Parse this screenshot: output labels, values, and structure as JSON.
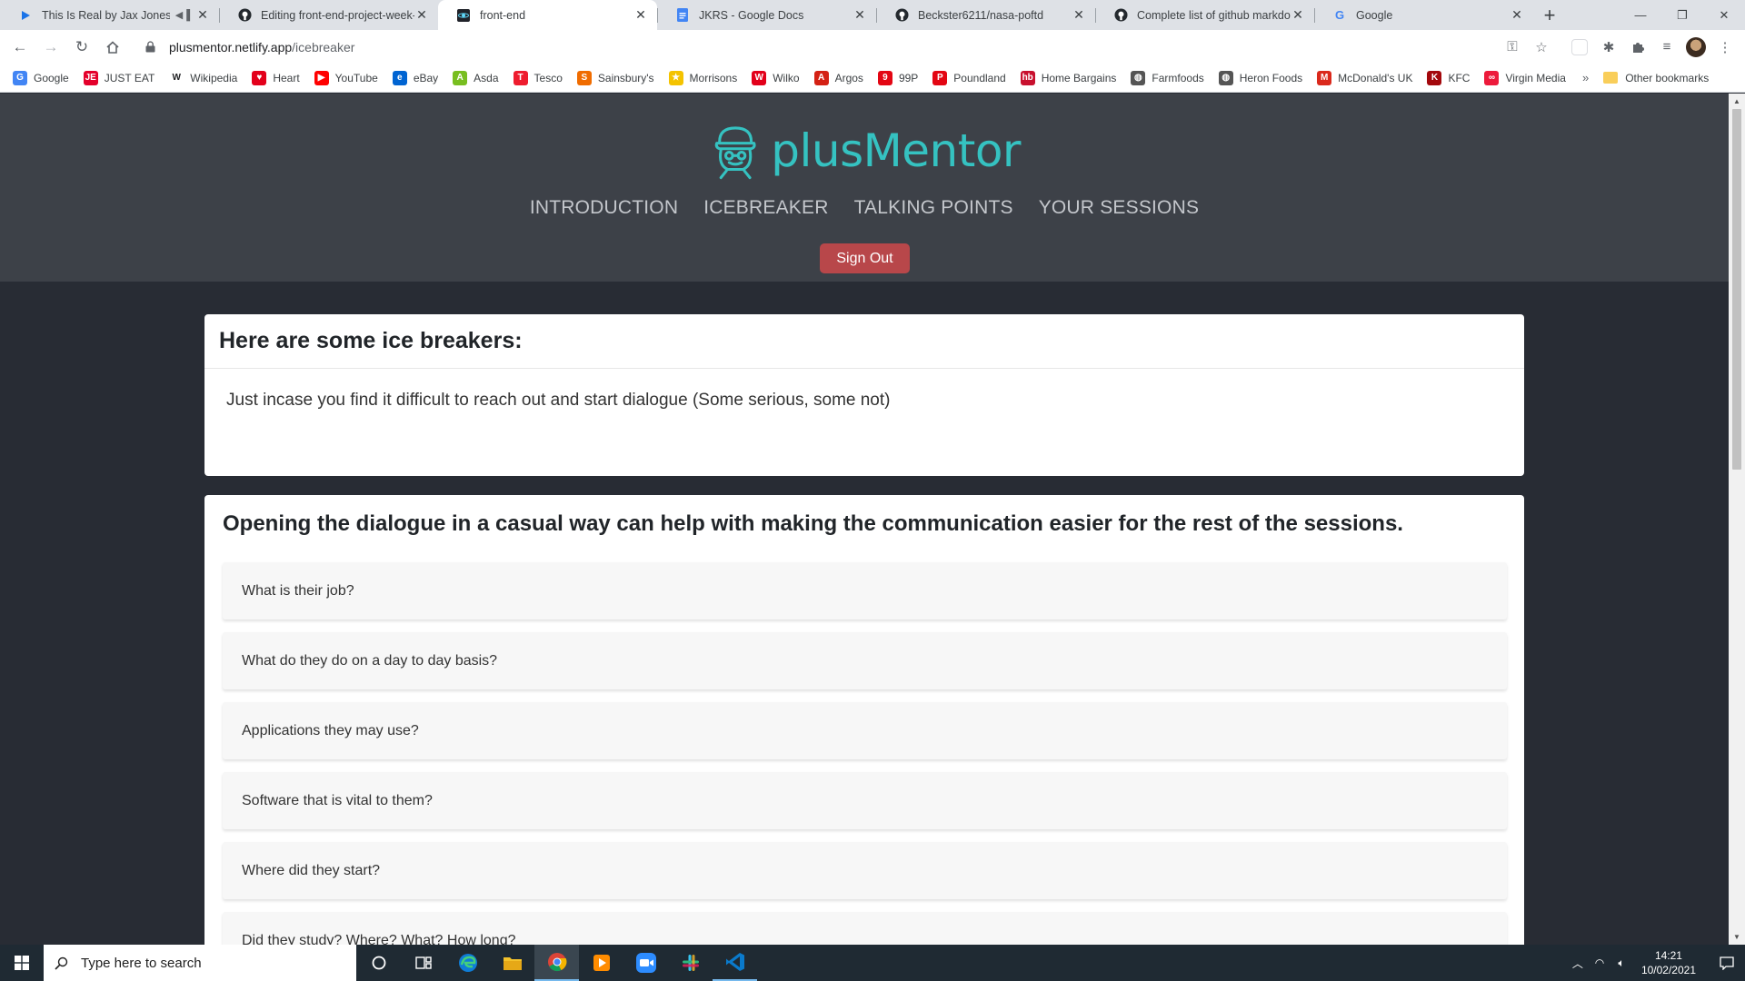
{
  "browser": {
    "tabs": [
      {
        "title": "This Is Real by Jax Jones Feat",
        "icon": "play-icon",
        "has_audio": true,
        "active": false
      },
      {
        "title": "Editing front-end-project-week-",
        "icon": "github-icon",
        "has_audio": false,
        "active": false
      },
      {
        "title": "front-end",
        "icon": "site-icon",
        "has_audio": false,
        "active": true
      },
      {
        "title": "JKRS - Google Docs",
        "icon": "docs-icon",
        "has_audio": false,
        "active": false
      },
      {
        "title": "Beckster6211/nasa-poftd",
        "icon": "github-icon",
        "has_audio": false,
        "active": false
      },
      {
        "title": "Complete list of github markdow",
        "icon": "github-icon",
        "has_audio": false,
        "active": false
      },
      {
        "title": "Google",
        "icon": "google-icon",
        "has_audio": false,
        "active": false
      }
    ],
    "url_host": "plusmentor.netlify.app",
    "url_path": "/icebreaker",
    "bookmarks": [
      {
        "label": "Google",
        "color": "#4285f4",
        "glyph": "G"
      },
      {
        "label": "JUST EAT",
        "color": "#e4002b",
        "glyph": "JE"
      },
      {
        "label": "Wikipedia",
        "color": "#ffffff",
        "glyph": "W"
      },
      {
        "label": "Heart",
        "color": "#e3001b",
        "glyph": "♥"
      },
      {
        "label": "YouTube",
        "color": "#ff0000",
        "glyph": "▶"
      },
      {
        "label": "eBay",
        "color": "#0064d2",
        "glyph": "e"
      },
      {
        "label": "Asda",
        "color": "#78be20",
        "glyph": "A"
      },
      {
        "label": "Tesco",
        "color": "#ee1c2e",
        "glyph": "T"
      },
      {
        "label": "Sainsbury's",
        "color": "#f06c00",
        "glyph": "S"
      },
      {
        "label": "Morrisons",
        "color": "#f4c300",
        "glyph": "★"
      },
      {
        "label": "Wilko",
        "color": "#e2001a",
        "glyph": "W"
      },
      {
        "label": "Argos",
        "color": "#d42114",
        "glyph": "A"
      },
      {
        "label": "99P",
        "color": "#e30613",
        "glyph": "9"
      },
      {
        "label": "Poundland",
        "color": "#e30613",
        "glyph": "P"
      },
      {
        "label": "Home Bargains",
        "color": "#c8102e",
        "glyph": "hb"
      },
      {
        "label": "Farmfoods",
        "color": "#555555",
        "glyph": "◍"
      },
      {
        "label": "Heron Foods",
        "color": "#555555",
        "glyph": "◍"
      },
      {
        "label": "McDonald's UK",
        "color": "#da291c",
        "glyph": "M"
      },
      {
        "label": "KFC",
        "color": "#a3080c",
        "glyph": "K"
      },
      {
        "label": "Virgin Media",
        "color": "#ed1a3b",
        "glyph": "∞"
      }
    ],
    "bookmarks_more": "»",
    "other_bookmarks": "Other bookmarks"
  },
  "site": {
    "logo_text": "plusMentor",
    "brand_color": "#35c2c1",
    "nav": [
      "INTRODUCTION",
      "ICEBREAKER",
      "TALKING POINTS",
      "YOUR SESSIONS"
    ],
    "sign_out_label": "Sign Out"
  },
  "intro": {
    "title": "Here are some ice breakers:",
    "body": "Just incase you find it difficult to reach out and start dialogue (Some serious, some not)"
  },
  "questions": {
    "heading": "Opening the dialogue in a casual way can help with making the communication easier for the rest of the sessions.",
    "items": [
      "What is their job?",
      "What do they do on a day to day basis?",
      "Applications they may use?",
      "Software that is vital to them?",
      "Where did they start?",
      "Did they study? Where? What? How long?"
    ]
  },
  "taskbar": {
    "search_placeholder": "Type here to search",
    "time": "14:21",
    "date": "10/02/2021"
  }
}
